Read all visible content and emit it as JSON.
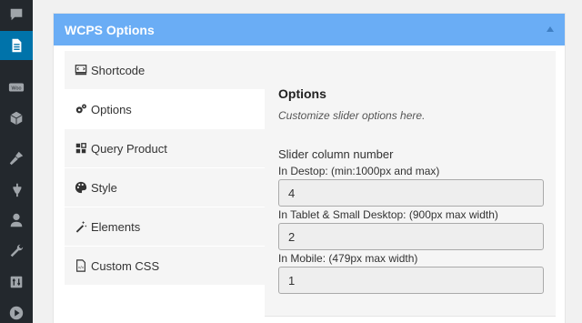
{
  "sidebar": {
    "icons": [
      "comments-icon",
      "pages-icon",
      "woocommerce-icon",
      "products-icon",
      "appearance-icon",
      "plugins-icon",
      "users-icon",
      "tools-icon",
      "settings-icon",
      "media-play-icon"
    ],
    "woo_label": "Woo",
    "active_color": "#0073aa",
    "bg_color": "#23282d"
  },
  "metabox": {
    "title": "WCPS Options",
    "header_color": "#6aadf5"
  },
  "tabs": [
    {
      "label": "Shortcode",
      "icon": "shortcode-icon"
    },
    {
      "label": "Options",
      "icon": "gears-icon",
      "active": true
    },
    {
      "label": "Query Product",
      "icon": "grid-icon"
    },
    {
      "label": "Style",
      "icon": "palette-icon"
    },
    {
      "label": "Elements",
      "icon": "wand-icon"
    },
    {
      "label": "Custom CSS",
      "icon": "css-file-icon"
    }
  ],
  "panel": {
    "title": "Options",
    "description": "Customize slider options here.",
    "field_label": "Slider column number",
    "desktop_label": "In Destop: (min:1000px and max)",
    "desktop_value": "4",
    "tablet_label": "In Tablet & Small Desktop: (900px max width)",
    "tablet_value": "2",
    "mobile_label": "In Mobile: (479px max width)",
    "mobile_value": "1"
  }
}
